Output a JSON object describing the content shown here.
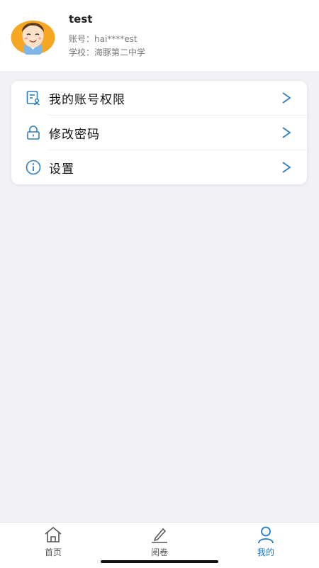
{
  "profile": {
    "name": "test",
    "account": "账号：hai****est",
    "school": "学校：海豚第二中学"
  },
  "menu": {
    "items": [
      {
        "label": "我的账号权限",
        "icon": "account-permission-icon"
      },
      {
        "label": "修改密码",
        "icon": "lock-icon"
      },
      {
        "label": "设置",
        "icon": "info-icon"
      }
    ]
  },
  "tabs": [
    {
      "label": "首页",
      "icon": "home-icon",
      "active": false
    },
    {
      "label": "阅卷",
      "icon": "pen-icon",
      "active": false
    },
    {
      "label": "我的",
      "icon": "user-icon",
      "active": true
    }
  ],
  "colors": {
    "accent": "#1f78c9",
    "background": "#f2f2f6"
  }
}
